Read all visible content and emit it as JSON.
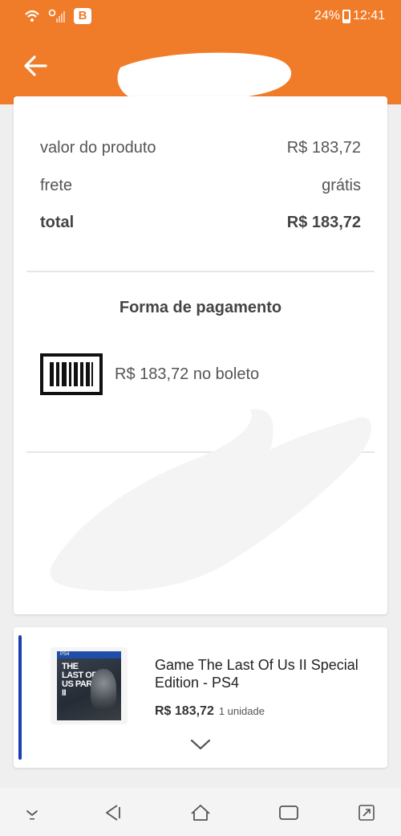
{
  "status_bar": {
    "badge": "B",
    "battery": "24%",
    "time": "12:41"
  },
  "summary": {
    "rows": [
      {
        "label": "valor do produto",
        "value": "R$ 183,72"
      },
      {
        "label": "frete",
        "value": "grátis"
      },
      {
        "label": "total",
        "value": "R$ 183,72"
      }
    ]
  },
  "payment": {
    "title": "Forma de pagamento",
    "text": "R$ 183,72 no boleto"
  },
  "product": {
    "name": "Game The Last Of Us II Special Edition - PS4",
    "price": "R$ 183,72",
    "quantity": "1 unidade",
    "cover_badge": "PS4",
    "cover_title": "THE LAST OF US PART II"
  },
  "colors": {
    "brand_orange": "#f07c2a",
    "accent_blue": "#1a3fb0"
  },
  "icons": {
    "back": "arrow-left",
    "payment": "barcode",
    "expand": "chevron-down",
    "nav": [
      "hide-keyboard",
      "back",
      "home",
      "recents",
      "rotate"
    ]
  }
}
